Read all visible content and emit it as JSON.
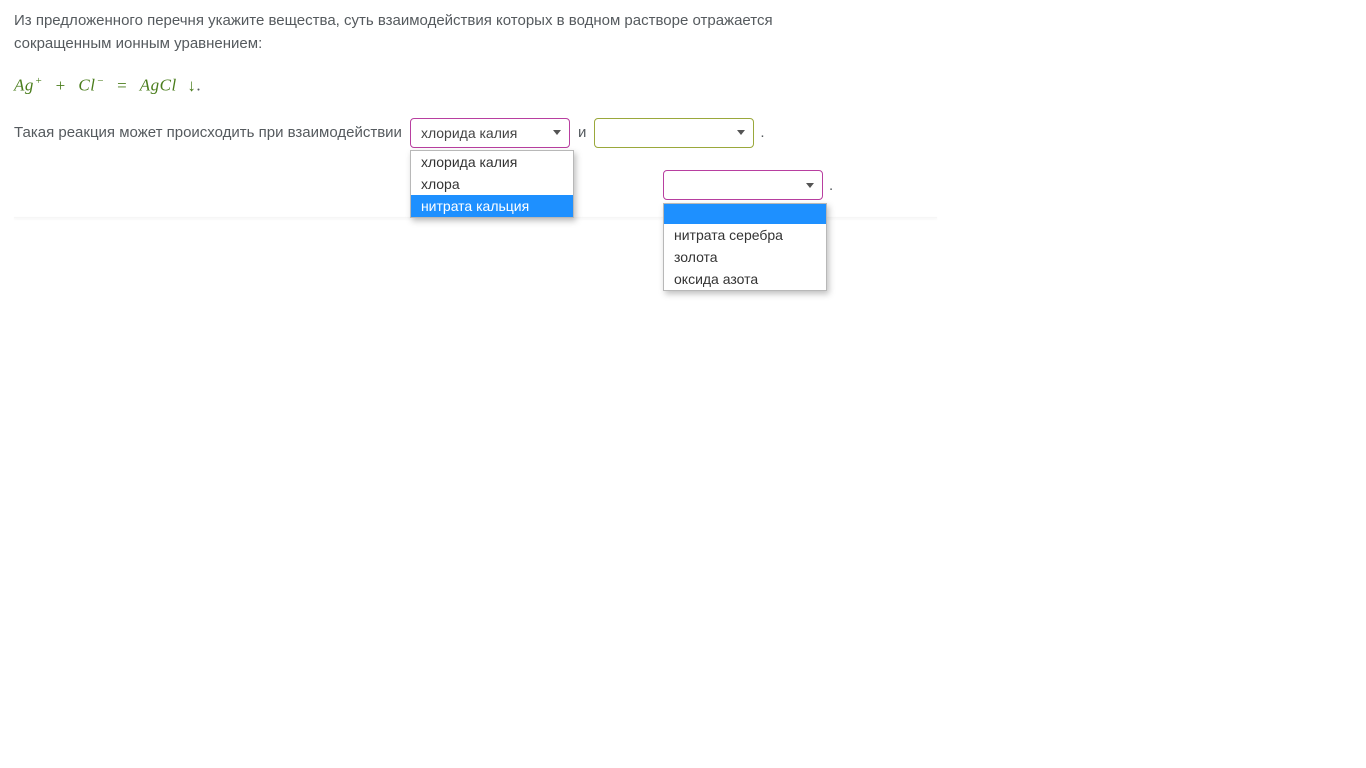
{
  "question": {
    "line1": "Из предложенного перечня укажите вещества, суть взаимодействия которых  в водном растворе отражается",
    "line2": "сокращенным ионным уравнением:"
  },
  "equation": {
    "part1": "Ag",
    "sup1": "+",
    "plus": "+",
    "part2": "Cl",
    "sup2": "−",
    "eq": "=",
    "part3": "AgCl",
    "arrow": "↓",
    "period": "."
  },
  "row1": {
    "label": "Такая реакция может происходить при взаимодействии",
    "select1_value": "хлорида калия",
    "conj": "и",
    "select2_value": "",
    "period": "."
  },
  "dropdown1": {
    "options": [
      "хлорида калия",
      "хлора",
      "нитрата кальция"
    ],
    "highlighted_index": 2
  },
  "row2": {
    "select_value": "",
    "period": "."
  },
  "dropdown2": {
    "blank": "",
    "options": [
      "нитрата серебра",
      "золота",
      "оксида азота"
    ],
    "highlighted_index": -1
  }
}
